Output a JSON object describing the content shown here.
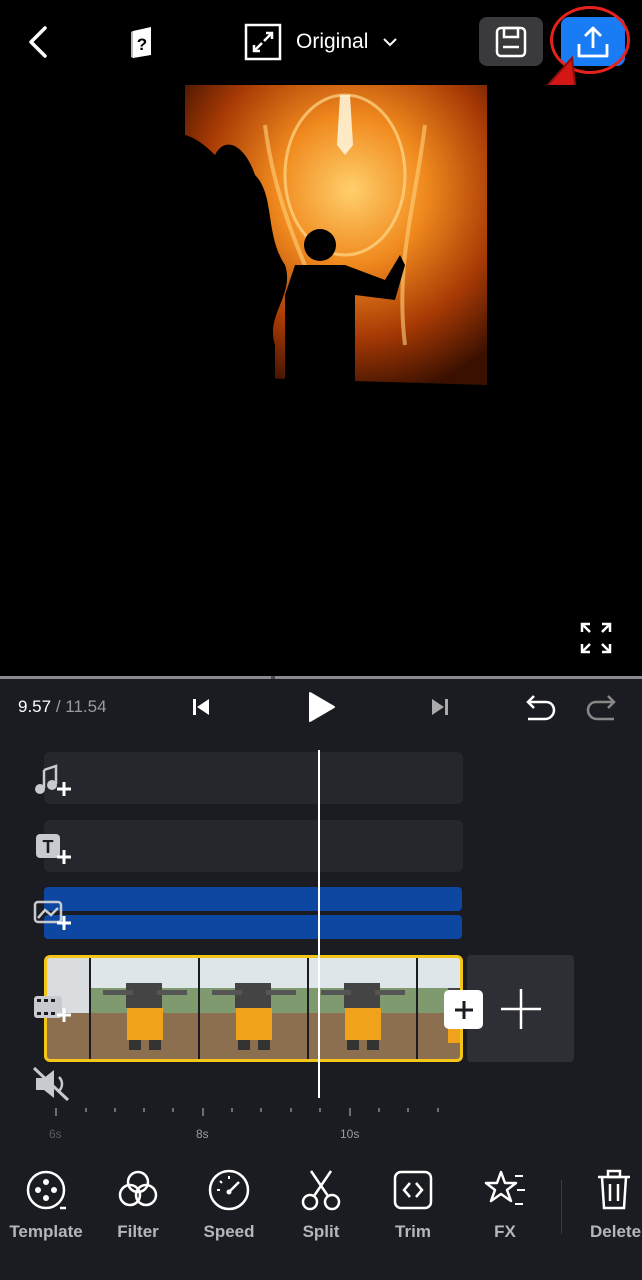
{
  "header": {
    "ratio_label": "Original",
    "export_label": "Export",
    "save_label": "Save draft"
  },
  "player": {
    "current_time": "9.57",
    "total_time": "11.54"
  },
  "timeline": {
    "ruler_labels": [
      "6s",
      "8s",
      "10s"
    ]
  },
  "toolbar": {
    "items": [
      {
        "label": "Template",
        "icon": "template-icon"
      },
      {
        "label": "Filter",
        "icon": "filter-icon"
      },
      {
        "label": "Speed",
        "icon": "speed-icon"
      },
      {
        "label": "Split",
        "icon": "scissors-icon"
      },
      {
        "label": "Trim",
        "icon": "trim-icon"
      },
      {
        "label": "FX",
        "icon": "star-icon"
      },
      {
        "label": "Delete",
        "icon": "trash-icon"
      }
    ]
  },
  "colors": {
    "accent": "#1a7cf5",
    "clip_border": "#f5c518",
    "overlay_track": "#0d47a1",
    "annotation": "#e8211b"
  }
}
